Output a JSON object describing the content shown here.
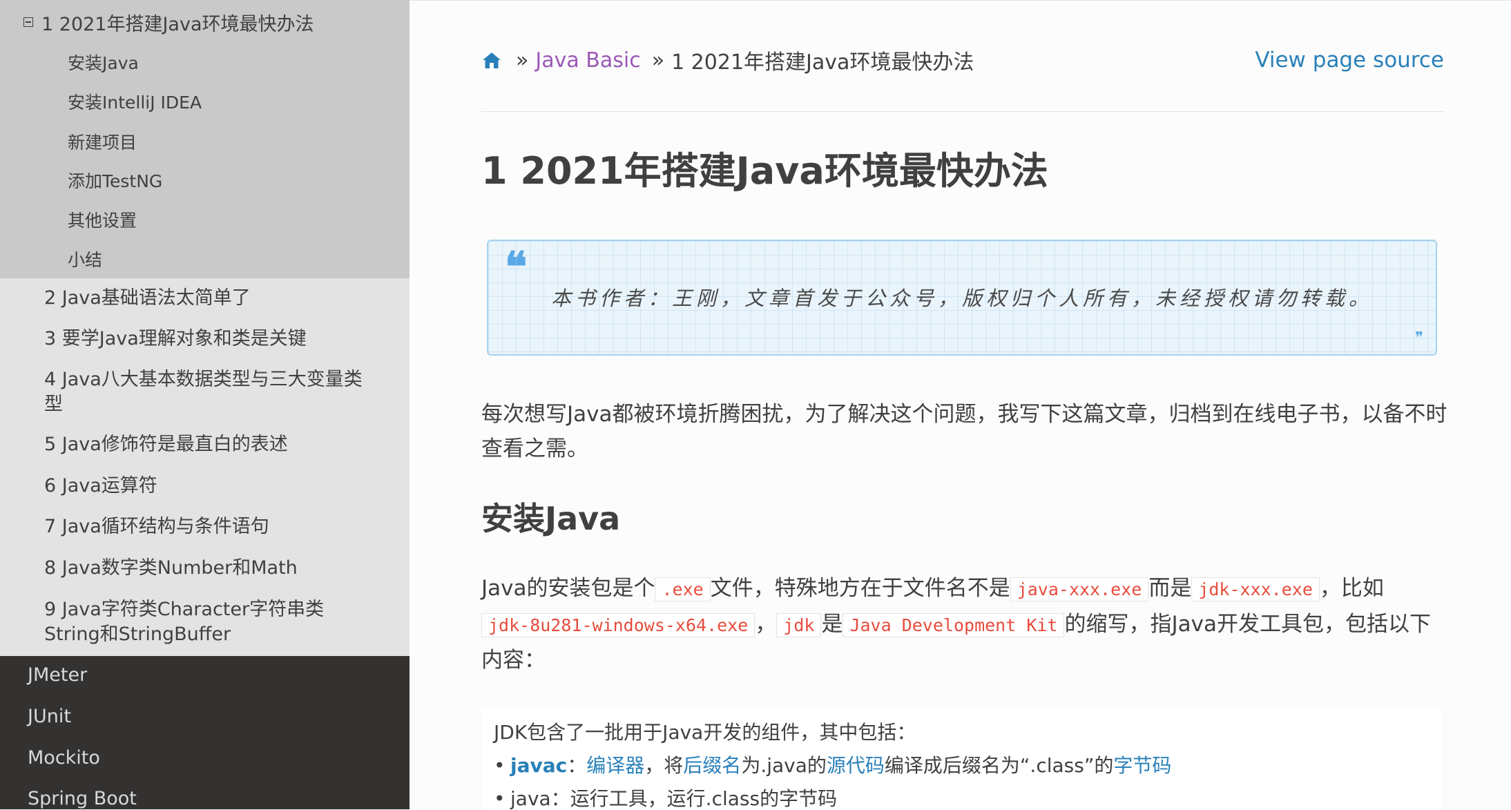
{
  "sidebar": {
    "current_page": "1 2021年搭建Java环境最快办法",
    "sub_items": [
      "安装Java",
      "安装IntelliJ IDEA",
      "新建项目",
      "添加TestNG",
      "其他设置",
      "小结"
    ],
    "chapters": [
      "2 Java基础语法太简单了",
      "3 要学Java理解对象和类是关键",
      "4 Java八大基本数据类型与三大变量类型",
      "5 Java修饰符是最直白的表述",
      "6 Java运算符",
      "7 Java循环结构与条件语句",
      "8 Java数字类Number和Math",
      "9 Java字符类Character字符串类String和StringBuffer"
    ],
    "top_items": [
      "JMeter",
      "JUnit",
      "Mockito",
      "Spring Boot"
    ]
  },
  "breadcrumb": {
    "home_icon": "home-icon",
    "separator": "»",
    "section": "Java Basic",
    "current": "1 2021年搭建Java环境最快办法"
  },
  "view_source": "View page source",
  "page_title": "1 2021年搭建Java环境最快办法",
  "quote": {
    "open_mark": "❝",
    "close_mark": "❞",
    "text": "本书作者：王刚，文章首发于公众号，版权归个人所有，未经授权请勿转载。"
  },
  "intro_paragraph": "每次想写Java都被环境折腾困扰，为了解决这个问题，我写下这篇文章，归档到在线电子书，以备不时查看之需。",
  "section_title": "安装Java",
  "install_paragraph": {
    "t1": "Java的安装包是个",
    "c1": ".exe",
    "t2": "文件，特殊地方在于文件名不是",
    "c2": "java-xxx.exe",
    "t3": "而是",
    "c3": "jdk-xxx.exe",
    "t4": "，比如",
    "c4": "jdk-8u281-windows-x64.exe",
    "t5": "，",
    "c5": "jdk",
    "t6": "是",
    "c6": "Java Development Kit",
    "t7": "的缩写，指Java开发工具包，包括以下内容："
  },
  "jdk_box": {
    "intro": "JDK包含了一批用于Java开发的组件，其中包括：",
    "item1": {
      "term": "javac",
      "colon": "：",
      "link1": "编译器",
      "t1": "，将",
      "link2": "后缀名",
      "t2": "为.java的",
      "link3": "源代码",
      "t3": "编译成后缀名为“.class”的",
      "link4": "字节码"
    },
    "item2": "java：运行工具，运行.class的字节码"
  },
  "colors": {
    "sidebar_dark": "#343131",
    "sidebar_current": "#c9c9c9",
    "sidebar_chapters": "#e3e3e3",
    "link": "#2980b9",
    "visited_link": "#9b59b6",
    "code": "#e74c3c"
  }
}
